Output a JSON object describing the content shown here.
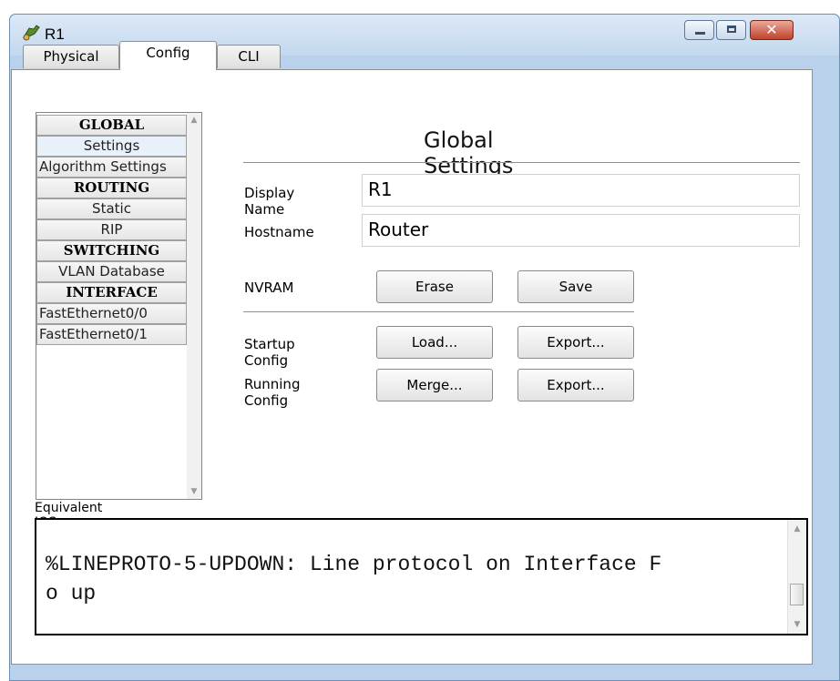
{
  "window": {
    "title": "R1"
  },
  "tabs": [
    {
      "label": "Physical"
    },
    {
      "label": "Config"
    },
    {
      "label": "CLI"
    }
  ],
  "sidebar": {
    "items": [
      {
        "label": "GLOBAL",
        "type": "header"
      },
      {
        "label": "Settings",
        "type": "item"
      },
      {
        "label": "Algorithm Settings",
        "type": "item"
      },
      {
        "label": "ROUTING",
        "type": "header"
      },
      {
        "label": "Static",
        "type": "item"
      },
      {
        "label": "RIP",
        "type": "item"
      },
      {
        "label": "SWITCHING",
        "type": "header"
      },
      {
        "label": "VLAN Database",
        "type": "item"
      },
      {
        "label": "INTERFACE",
        "type": "header"
      },
      {
        "label": "FastEthernet0/0",
        "type": "item"
      },
      {
        "label": "FastEthernet0/1",
        "type": "item"
      }
    ]
  },
  "global_settings": {
    "title": "Global Settings",
    "display_name_label": "Display Name",
    "display_name_value": "R1",
    "hostname_label": "Hostname",
    "hostname_value": "Router",
    "nvram_label": "NVRAM",
    "erase_button": "Erase",
    "save_button": "Save",
    "startup_config_label": "Startup Config",
    "startup_load_button": "Load...",
    "startup_export_button": "Export...",
    "running_config_label": "Running Config",
    "running_merge_button": "Merge...",
    "running_export_button": "Export..."
  },
  "ios_commands": {
    "label": "Equivalent IOS Commands",
    "line1": "%LINEPROTO-5-UPDOWN: Line protocol on Interface F",
    "line2": "o up"
  },
  "colors": {
    "titlebar": "#c3d8ee",
    "close_button": "#c0422b"
  }
}
